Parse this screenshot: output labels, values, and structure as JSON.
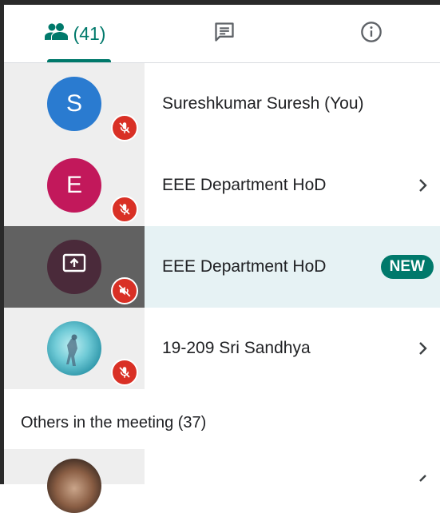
{
  "tabs": {
    "people_count": "(41)",
    "people_icon": "people-icon",
    "chat_icon": "chat-icon",
    "info_icon": "info-icon"
  },
  "participants": [
    {
      "initial": "S",
      "name": "Sureshkumar Suresh (You)",
      "avatar_color": "#2a7bd0",
      "muted": true,
      "chevron": false
    },
    {
      "initial": "E",
      "name": "EEE Department HoD",
      "avatar_color": "#c2185b",
      "muted": true,
      "chevron": true
    },
    {
      "initial": "",
      "name": "EEE Department HoD",
      "avatar_color": "#4a2a3a",
      "icon": "screen-share-icon",
      "badge": "NEW",
      "audio_off": true,
      "highlighted": true
    },
    {
      "initial": "",
      "name": "19-209 Sri Sandhya",
      "avatar_type": "photo",
      "muted": true,
      "chevron": true
    }
  ],
  "others_section": {
    "title": "Others in the meeting (37)"
  },
  "colors": {
    "accent": "#00796b",
    "mute_red": "#d93025",
    "highlight_bg": "#e6f2f4"
  }
}
